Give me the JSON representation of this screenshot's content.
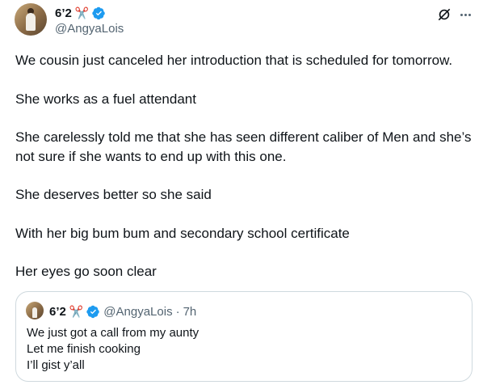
{
  "author": {
    "display_name": "6’2",
    "emoji": "✂️",
    "handle": "@AngyaLois",
    "verified": true
  },
  "icons": {
    "grok": "grok-icon",
    "more": "more-icon",
    "verified": "verified-badge-icon"
  },
  "colors": {
    "verified_blue": "#1d9bf0",
    "secondary_text": "#536471",
    "border": "#cfd9de"
  },
  "tweet": {
    "paragraphs": [
      "We cousin just canceled her introduction that is scheduled for tomorrow.",
      "She works as a fuel attendant",
      "She carelessly told me that she has seen different caliber of Men and she’s not sure if she wants to end up with this one.",
      "She deserves better so she said",
      "With her big bum bum and  secondary school certificate",
      "Her eyes go soon clear"
    ]
  },
  "quoted": {
    "display_name": "6’2",
    "emoji": "✂️",
    "handle": "@AngyaLois",
    "separator": "·",
    "time": "7h",
    "lines": [
      "We just got a call from my aunty",
      "Let me finish cooking",
      "I’ll gist y’all"
    ]
  }
}
